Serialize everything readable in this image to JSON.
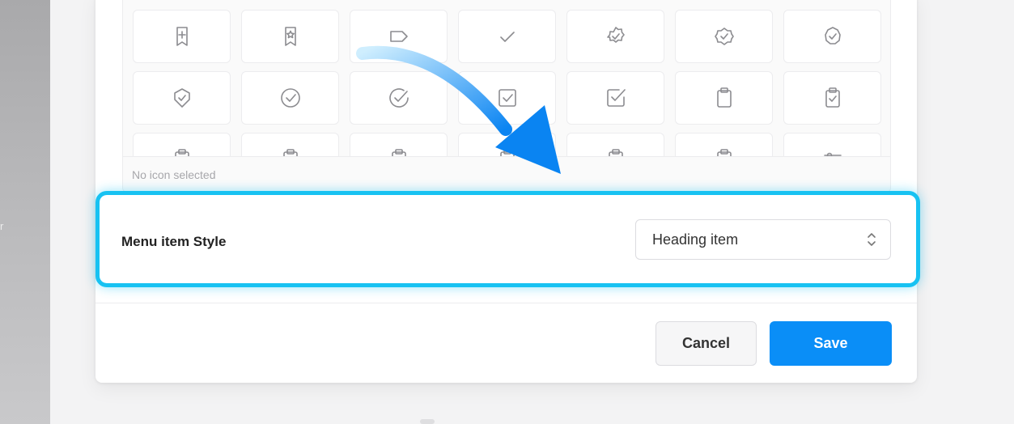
{
  "background_fragment": "r",
  "icon_picker": {
    "icons": [
      "bookmark-plus-icon",
      "bookmark-star-icon",
      "tag-icon",
      "check-icon",
      "badge-check-icon",
      "badge-check-2-icon",
      "badge-check-3-icon",
      "shield-check-icon",
      "circle-check-icon",
      "circle-check-2-icon",
      "square-check-icon",
      "square-check-2-icon",
      "clipboard-icon",
      "clipboard-check-icon",
      "clipboard-icon",
      "clipboard-icon",
      "clipboard-icon",
      "clipboard-icon",
      "clipboard-icon",
      "clipboard-icon",
      "adjustments-icon"
    ],
    "status": "No icon selected"
  },
  "menu_item_style": {
    "label": "Menu item Style",
    "selected": "Heading item"
  },
  "footer": {
    "cancel_label": "Cancel",
    "save_label": "Save"
  },
  "colors": {
    "highlight": "#17c2f2",
    "primary": "#0a8ef7",
    "arrow_start": "#cfeefe",
    "arrow_end": "#0a84f2"
  }
}
